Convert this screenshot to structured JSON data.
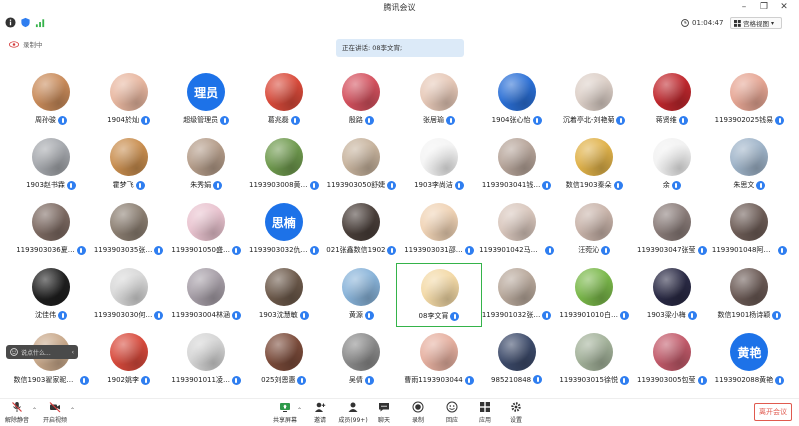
{
  "app": {
    "title": "腾讯会议",
    "timer": "01:04:47",
    "view_mode": "宫格视图",
    "recording_label": "录制中",
    "speaking": "正在讲话: 08李文宵;",
    "chat_placeholder": "说点什么..."
  },
  "colors": {
    "accent": "#2f7ef0",
    "active_border": "#35b34a",
    "end_button": "#e05a4f"
  },
  "participants": [
    {
      "name": "周孙骏",
      "avatar_color": "#c98b5a"
    },
    {
      "name": "1904於灿",
      "avatar_color": "#e8b7a0"
    },
    {
      "name": "超级管理员",
      "avatar_color": "#1d72e8",
      "avatar_text": "理员"
    },
    {
      "name": "葛兆磊",
      "avatar_color": "#d94a3a"
    },
    {
      "name": "殷路",
      "avatar_color": "#d4515e"
    },
    {
      "name": "张居瑜",
      "avatar_color": "#e7c9b8"
    },
    {
      "name": "1904张心怡",
      "avatar_color": "#2a6fd6"
    },
    {
      "name": "沉着亭北-刘艳菊",
      "avatar_color": "#ddd0c8"
    },
    {
      "name": "蒋贤维",
      "avatar_color": "#c0272d"
    },
    {
      "name": "1193902025钱易",
      "avatar_color": "#e6a694"
    },
    {
      "name": "1903赵书霖",
      "avatar_color": "#a5a8ad"
    },
    {
      "name": "霍梦飞",
      "avatar_color": "#c98e4f"
    },
    {
      "name": "朱秀娟",
      "avatar_color": "#b59d8a"
    },
    {
      "name": "1193903008黄…",
      "avatar_color": "#6f9a4e"
    },
    {
      "name": "1193903050舒婕",
      "avatar_color": "#c7b39d"
    },
    {
      "name": "1903李尚洁",
      "avatar_color": "#f4f4f4"
    },
    {
      "name": "1193903041钱…",
      "avatar_color": "#b7a59a"
    },
    {
      "name": "数信1903秦朵",
      "avatar_color": "#e0b24a"
    },
    {
      "name": "余",
      "avatar_color": "#f2f2f2"
    },
    {
      "name": "朱思文",
      "avatar_color": "#9fb4c9"
    },
    {
      "name": "1193903036夏…",
      "avatar_color": "#7d6a62"
    },
    {
      "name": "1193903035张…",
      "avatar_color": "#8c7f72"
    },
    {
      "name": "1193901050盛…",
      "avatar_color": "#e9c3cf"
    },
    {
      "name": "1193903032仇…",
      "avatar_color": "#1d72e8",
      "avatar_text": "思楠"
    },
    {
      "name": "021张鑫数信1902",
      "avatar_color": "#4a3f3a"
    },
    {
      "name": "1193903031邵…",
      "avatar_color": "#f0d3b5"
    },
    {
      "name": "1193901042马泳儿",
      "avatar_color": "#d9c7bd"
    },
    {
      "name": "汪菀沁",
      "avatar_color": "#c9b4aa"
    },
    {
      "name": "1193903047张莹",
      "avatar_color": "#8a7c79"
    },
    {
      "name": "1193901048阿依怕…",
      "avatar_color": "#6e5d57"
    },
    {
      "name": "沈佳伟",
      "avatar_color": "#1f1f1f"
    },
    {
      "name": "1193903030何…",
      "avatar_color": "#d8d8d8"
    },
    {
      "name": "1193903004林涵",
      "avatar_color": "#a79fa8"
    },
    {
      "name": "1903沈慧敏",
      "avatar_color": "#6d5a4b"
    },
    {
      "name": "黄源",
      "avatar_color": "#88b3d9"
    },
    {
      "name": "08李文宵",
      "avatar_color": "#f3d9a6",
      "active": true
    },
    {
      "name": "1193901032张…",
      "avatar_color": "#b9a99c"
    },
    {
      "name": "1193901010白…",
      "avatar_color": "#7ab84a"
    },
    {
      "name": "1903梁小梅",
      "avatar_color": "#2a2a45"
    },
    {
      "name": "数信1901杨诗颖",
      "avatar_color": "#6b5a55"
    },
    {
      "name": "数信1903翟家昵119…",
      "avatar_color": "#c9a98b"
    },
    {
      "name": "1902姚李",
      "avatar_color": "#d84a3c"
    },
    {
      "name": "1193901011凌…",
      "avatar_color": "#d5d5d5"
    },
    {
      "name": "025刘恩惠",
      "avatar_color": "#7b4b3a"
    },
    {
      "name": "吴倩",
      "avatar_color": "#8b8b8b"
    },
    {
      "name": "曹雨1193903044",
      "avatar_color": "#e6b0a0"
    },
    {
      "name": "985210848",
      "avatar_color": "#3c4a6a"
    },
    {
      "name": "1193903015徐悦",
      "avatar_color": "#a3b29a"
    },
    {
      "name": "1193903005包莹",
      "avatar_color": "#c25a6a"
    },
    {
      "name": "1193902088黄艳",
      "avatar_color": "#1d72e8",
      "avatar_text": "黄艳"
    }
  ],
  "toolbar": {
    "mute": "解除静音",
    "video": "开启视频",
    "share": "共享屏幕",
    "invite": "邀请",
    "members": "成员(99+)",
    "chat": "聊天",
    "record": "录制",
    "reactions": "回应",
    "apps": "应用",
    "settings": "设置",
    "end": "离开会议"
  }
}
